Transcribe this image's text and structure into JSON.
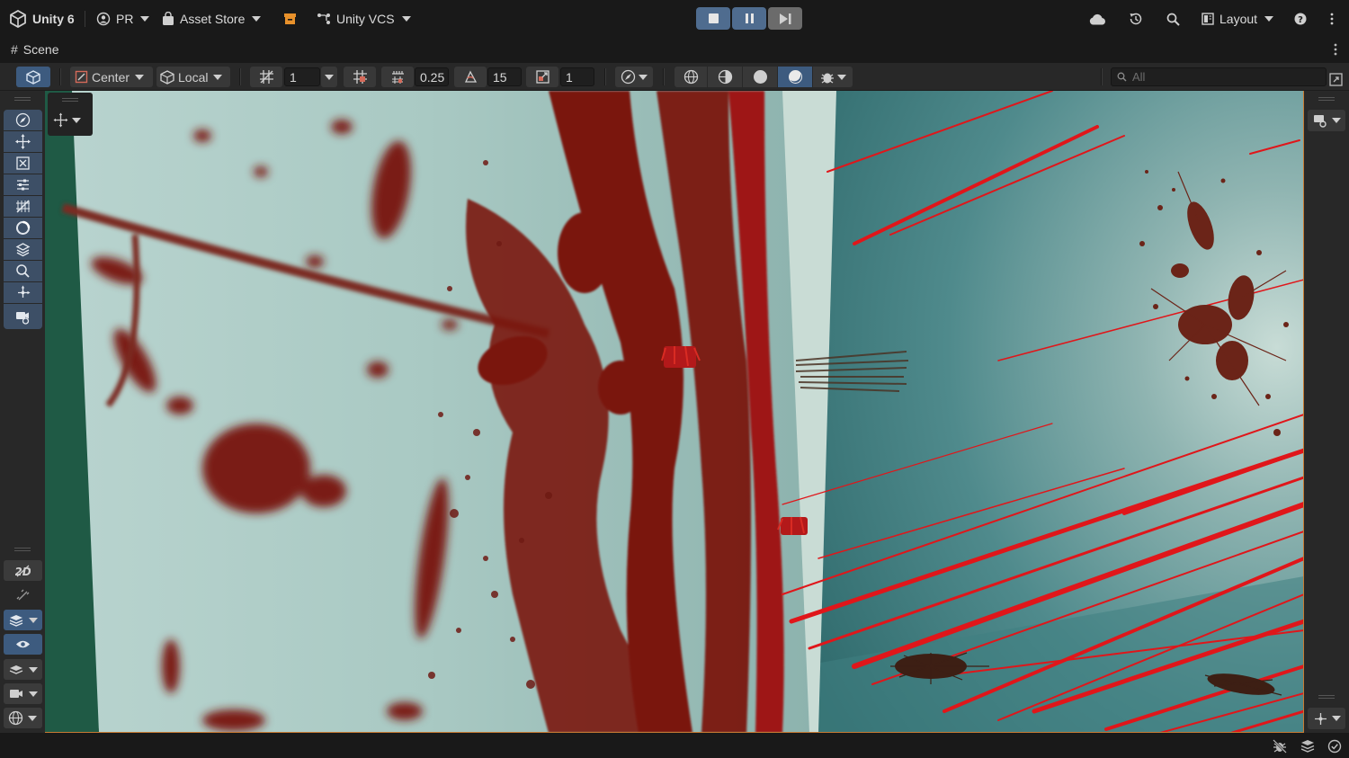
{
  "topbar": {
    "app_title": "Unity 6",
    "account": "PR",
    "asset_store": "Asset Store",
    "vcs": "Unity VCS",
    "layout": "Layout"
  },
  "scene_tab": {
    "label": "Scene"
  },
  "scene_toolbar": {
    "pivot_mode": "Center",
    "pivot_rotation": "Local",
    "grid_move_value": "1",
    "snap_increment": "0.25",
    "rotate_snap": "15",
    "scale_snap": "1",
    "search_placeholder": "All"
  },
  "colors": {
    "accent_blue": "#4f6c8f",
    "viewport_border": "#c77a33",
    "teal_wall": "#3f7d7f",
    "blood_red": "#7a1510",
    "streak_red": "#e0161a"
  },
  "icons": {
    "left_tools": [
      "view-tool-icon",
      "move-tool-icon",
      "rotate-tool-icon",
      "scale-tool-icon",
      "rect-tool-icon",
      "transform-tool-icon",
      "custom-tool-icon",
      "zoom-tool-icon",
      "pivot-tool-icon",
      "camera-tool-icon"
    ]
  }
}
